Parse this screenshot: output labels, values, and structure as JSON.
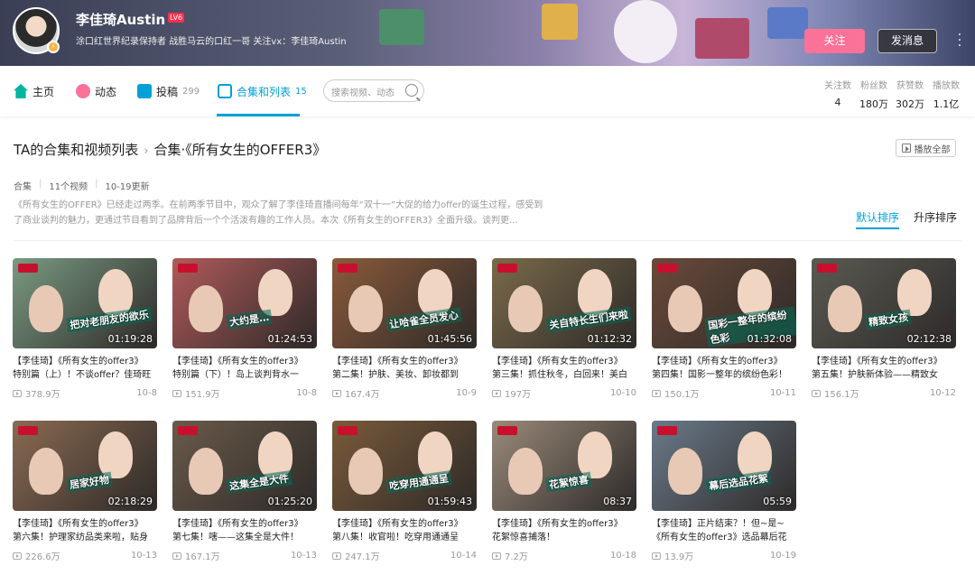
{
  "header": {
    "username": "李佳琦Austin",
    "level": "LV6",
    "signature": "涂口红世界纪录保持者 战胜马云的口红一哥 关注vx：李佳琦Austin",
    "follow_label": "关注",
    "message_label": "发消息"
  },
  "nav": {
    "items": [
      {
        "label": "主页",
        "count": ""
      },
      {
        "label": "动态",
        "count": ""
      },
      {
        "label": "投稿",
        "count": "299"
      },
      {
        "label": "合集和列表",
        "count": "15"
      }
    ],
    "search_placeholder": "搜索视频、动态"
  },
  "stats": [
    {
      "label": "关注数",
      "value": "4"
    },
    {
      "label": "粉丝数",
      "value": "180万"
    },
    {
      "label": "获赞数",
      "value": "302万"
    },
    {
      "label": "播放数",
      "value": "1.1亿"
    }
  ],
  "collection": {
    "breadcrumb_root": "TA的合集和视频列表",
    "breadcrumb_sep": "›",
    "title": "合集·《所有女生的OFFER3》",
    "play_all": "播放全部",
    "type": "合集",
    "video_count": "11个视频",
    "update": "10-19更新",
    "description": "《所有女生的OFFER》已经走过两季。在前两季节目中，观众了解了李佳琦直播间每年“双十一”大促的给力offer的诞生过程，感受到了商业谈判的魅力，更通过节目看到了品牌背后一个个活泼有趣的工作人员。本次《所有女生的OFFER3》全面升级。谈判更...",
    "sort_default": "默认排序",
    "sort_asc": "升序排序"
  },
  "videos": [
    {
      "duration": "01:19:28",
      "caption": "把对老朋友的欲乐",
      "title1": "【李佳琦】《所有女生的offer3》",
      "title2": "特别篇（上）！不谈offer？佳琦旺",
      "plays": "378.9万",
      "date": "10-8",
      "bg": "#7a9a82"
    },
    {
      "duration": "01:24:53",
      "caption": "大约是…",
      "title1": "【李佳琦】《所有女生的offer3》",
      "title2": "特别篇（下）！岛上谈判背水一",
      "plays": "151.9万",
      "date": "10-8",
      "bg": "#b05a5a"
    },
    {
      "duration": "01:45:56",
      "caption": "让哈雀全员发心",
      "title1": "【李佳琦】《所有女生的offer3》",
      "title2": "第二集！护肤、美妆、卸妆都到",
      "plays": "167.4万",
      "date": "10-9",
      "bg": "#8a5a3a"
    },
    {
      "duration": "01:12:32",
      "caption": "关自特长生们来啦",
      "title1": "【李佳琦】《所有女生的offer3》",
      "title2": "第三集！抓住秋冬，白回来！美白",
      "plays": "197万",
      "date": "10-10",
      "bg": "#7a6a4a"
    },
    {
      "duration": "01:32:08",
      "caption": "国彩一整年的缤纷色彩",
      "title1": "【李佳琦】《所有女生的offer3》",
      "title2": "第四集！国影一整年的缤纷色彩！",
      "plays": "150.1万",
      "date": "10-11",
      "bg": "#6a4a3a"
    },
    {
      "duration": "02:12:38",
      "caption": "精致女孩",
      "title1": "【李佳琦】《所有女生的offer3》",
      "title2": "第五集！护肤新体验——精致女",
      "plays": "156.1万",
      "date": "10-12",
      "bg": "#5a5a52"
    },
    {
      "duration": "02:18:29",
      "caption": "居家好物",
      "title1": "【李佳琦】《所有女生的offer3》",
      "title2": "第六集！护理家纺品类来啦，贴身",
      "plays": "226.6万",
      "date": "10-13",
      "bg": "#8a6a52"
    },
    {
      "duration": "01:25:20",
      "caption": "这集全是大件",
      "title1": "【李佳琦】《所有女生的offer3》",
      "title2": "第七集！嗐——这集全是大件！",
      "plays": "167.1万",
      "date": "10-13",
      "bg": "#6a5a4a"
    },
    {
      "duration": "01:59:43",
      "caption": "吃穿用通通呈",
      "title1": "【李佳琦】《所有女生的offer3》",
      "title2": "第八集！收官啦！吃穿用通通呈",
      "plays": "247.1万",
      "date": "10-14",
      "bg": "#7a5a3a"
    },
    {
      "duration": "08:37",
      "caption": "花絮惊喜",
      "title1": "【李佳琦】《所有女生的offer3》",
      "title2": "花絮惊喜捕落！",
      "plays": "7.2万",
      "date": "10-18",
      "bg": "#9a8a7a"
    },
    {
      "duration": "05:59",
      "caption": "幕后选品花絮",
      "title1": "【李佳琦】正片结束？！但~是~",
      "title2": "《所有女生的offer3》选品幕后花",
      "plays": "13.9万",
      "date": "10-19",
      "bg": "#6a7a8a"
    }
  ],
  "colors": {
    "accent": "#00a1d6",
    "follow": "#fb7299",
    "title_caption_red": "#c8102e"
  }
}
